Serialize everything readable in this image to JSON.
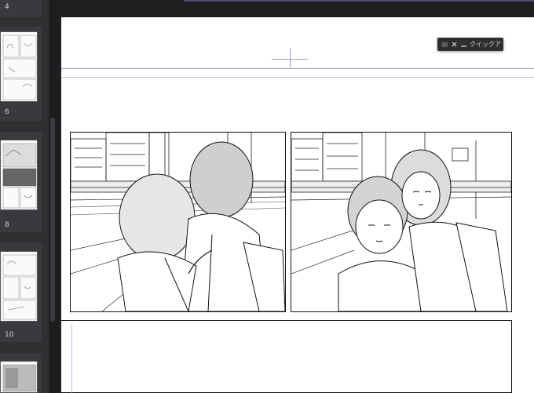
{
  "pages_panel": {
    "items": [
      {
        "number": "4"
      },
      {
        "number": "6"
      },
      {
        "number": "8"
      },
      {
        "number": "10"
      }
    ]
  },
  "quick_access": {
    "title": "クイックア"
  },
  "colors": {
    "app_bg": "#202022",
    "sidebar_bg": "#303033",
    "guide": "#9a9ad8",
    "page": "#ffffff"
  }
}
